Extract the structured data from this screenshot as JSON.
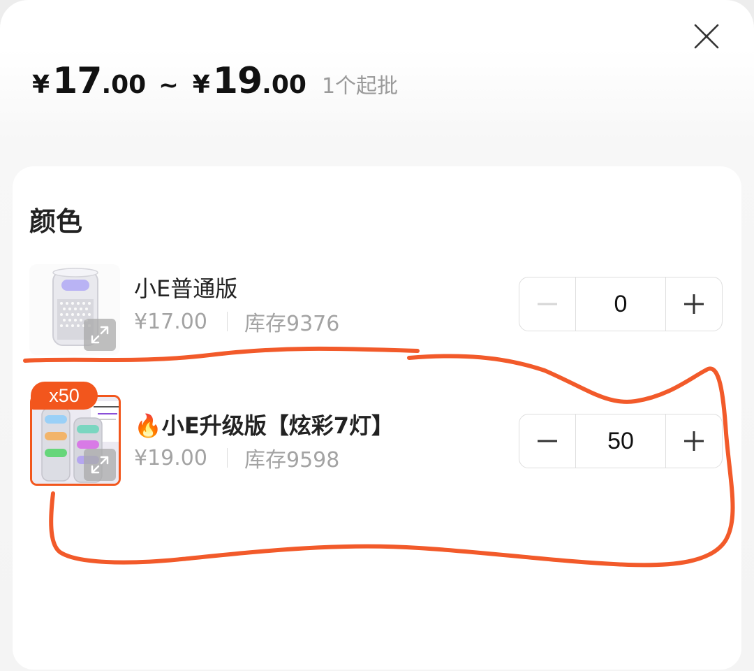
{
  "header": {
    "price_low": {
      "currency": "¥",
      "integer": "17",
      "decimal": ".00"
    },
    "tilde": "~",
    "price_high": {
      "currency": "¥",
      "integer": "19",
      "decimal": ".00"
    },
    "moq": "1个起批",
    "close_icon": "close-icon"
  },
  "section": {
    "title": "颜色"
  },
  "variants": [
    {
      "name": "小E普通版",
      "price": "¥17.00",
      "stock": "库存9376",
      "quantity": "0",
      "selected": false,
      "minus_enabled": false
    },
    {
      "badge": "x50",
      "name": "🔥小E升级版【炫彩7灯】",
      "price": "¥19.00",
      "stock": "库存9598",
      "quantity": "50",
      "selected": true,
      "minus_enabled": true
    }
  ],
  "colors": {
    "accent": "#f2561d",
    "annotation": "#f25a2a",
    "text_primary": "#222222",
    "text_muted": "#a3a3a3"
  }
}
